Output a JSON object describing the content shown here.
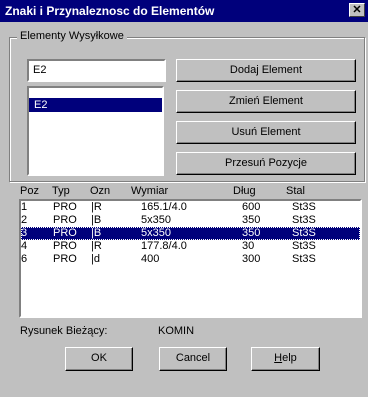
{
  "window": {
    "title": "Znaki i Przynaleznosc do Elementów",
    "close_label": "✕"
  },
  "elements_group": {
    "legend": "Elementy Wysyłkowe",
    "current_value": "E2",
    "list_items": [
      "E2"
    ],
    "selected_index": 0
  },
  "buttons": {
    "add": "Dodaj Element",
    "change": "Zmień Element",
    "remove": "Usuń Element",
    "move": "Przesuń Pozycje",
    "ok": "OK",
    "cancel": "Cancel",
    "help_underlined": "H",
    "help_rest": "elp"
  },
  "parts_table": {
    "columns": [
      "Poz",
      "Typ",
      "Ozn",
      "Wymiar",
      "Dług",
      "Stal"
    ],
    "rows": [
      [
        "1",
        "PRO",
        "|R",
        "165.1/4.0",
        "600",
        "St3S"
      ],
      [
        "2",
        "PRO",
        "|B",
        "5x350",
        "350",
        "St3S"
      ],
      [
        "3",
        "PRO",
        "|B",
        "5x350",
        "350",
        "St3S"
      ],
      [
        "4",
        "PRO",
        "|R",
        "177.8/4.0",
        "30",
        "St3S"
      ],
      [
        "6",
        "PRO",
        "|d",
        "400",
        "300",
        "St3S"
      ]
    ],
    "selected_index": 2
  },
  "drawing": {
    "label": "Rysunek Bieżący:",
    "value": "KOMIN"
  },
  "colors": {
    "dialog_face": "#c0c0c0",
    "title_bar": "#00007b",
    "selection": "#00007b"
  }
}
